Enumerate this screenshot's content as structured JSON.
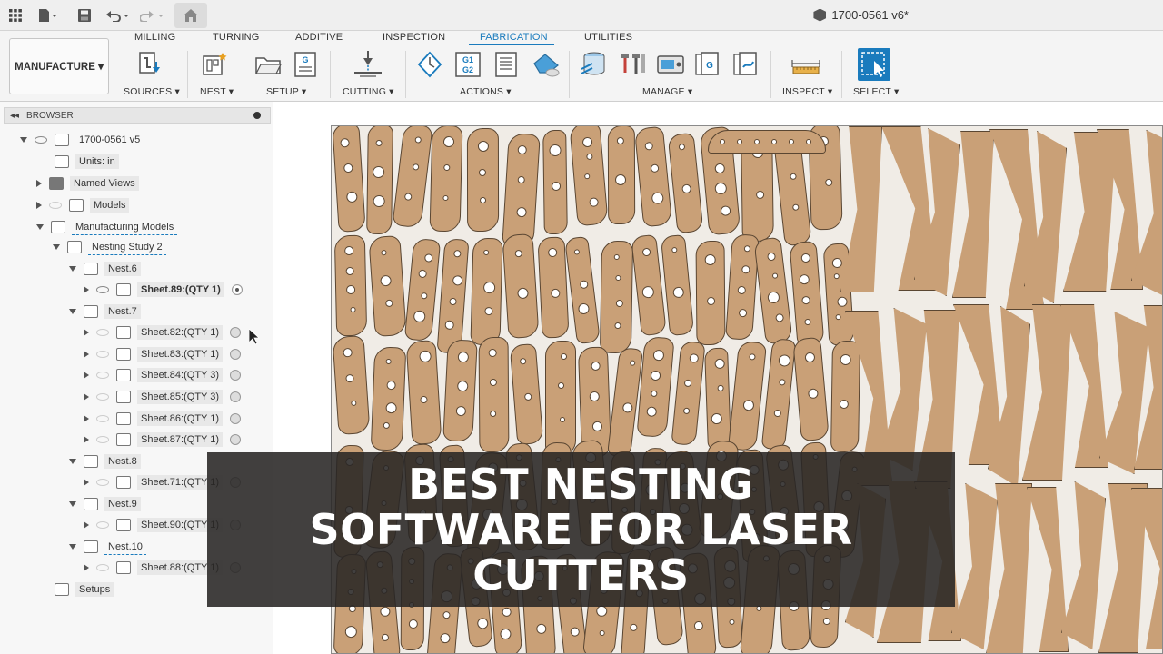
{
  "topbar": {
    "document_title": "1700-0561 v6*"
  },
  "workspace": {
    "label": "MANUFACTURE ▾"
  },
  "tabs": [
    {
      "label": "MILLING",
      "active": false
    },
    {
      "label": "TURNING",
      "active": false
    },
    {
      "label": "ADDITIVE",
      "active": false
    },
    {
      "label": "INSPECTION",
      "active": false
    },
    {
      "label": "FABRICATION",
      "active": true
    },
    {
      "label": "UTILITIES",
      "active": false
    }
  ],
  "groups": [
    {
      "label": "SOURCES ▾"
    },
    {
      "label": "NEST ▾"
    },
    {
      "label": "SETUP ▾"
    },
    {
      "label": "CUTTING ▾"
    },
    {
      "label": "ACTIONS ▾"
    },
    {
      "label": "MANAGE ▾"
    },
    {
      "label": "INSPECT ▾"
    },
    {
      "label": "SELECT ▾"
    }
  ],
  "icons": {
    "g1g2_line1": "G1",
    "g1g2_line2": "G2",
    "g_doc": "G"
  },
  "browser": {
    "title": "BROWSER",
    "root": "1700-0561 v5",
    "units": "Units: in",
    "named_views": "Named Views",
    "models": "Models",
    "manufacturing_models": "Manufacturing Models",
    "nesting_study": "Nesting Study 2",
    "nests": [
      {
        "label": "Nest.6",
        "sheets": [
          "Sheet.89:(QTY 1)"
        ]
      },
      {
        "label": "Nest.7",
        "sheets": [
          "Sheet.82:(QTY 1)",
          "Sheet.83:(QTY 1)",
          "Sheet.84:(QTY 3)",
          "Sheet.85:(QTY 3)",
          "Sheet.86:(QTY 1)",
          "Sheet.87:(QTY 1)"
        ]
      },
      {
        "label": "Nest.8",
        "sheets": [
          "Sheet.71:(QTY 1)"
        ]
      },
      {
        "label": "Nest.9",
        "sheets": [
          "Sheet.90:(QTY 1)"
        ]
      },
      {
        "label": "Nest.10",
        "sheets": [
          "Sheet.88:(QTY 1)"
        ]
      }
    ],
    "setups": "Setups"
  },
  "banner": {
    "line1": "BEST NESTING",
    "line2": "SOFTWARE FOR LASER",
    "line3": "CUTTERS"
  },
  "colors": {
    "accent": "#1a7bbd",
    "part_fill": "#c9a077",
    "part_stroke": "#5a4632",
    "sheet_bg": "#f0ece6"
  }
}
